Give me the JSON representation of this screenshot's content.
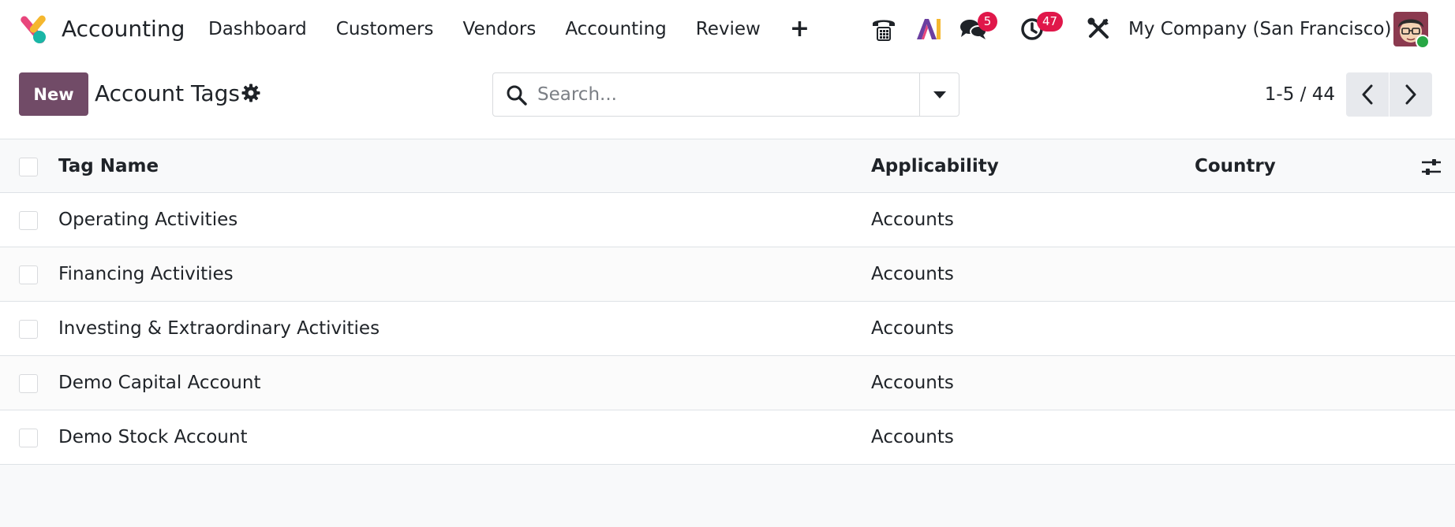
{
  "app": {
    "name": "Accounting",
    "menu": [
      "Dashboard",
      "Customers",
      "Vendors",
      "Accounting",
      "Review"
    ],
    "menu_plus": "+"
  },
  "systray": {
    "messages_count": "5",
    "activities_count": "47",
    "company": "My Company (San Francisco)"
  },
  "control": {
    "new_label": "New",
    "title": "Account Tags",
    "search_placeholder": "Search...",
    "pager": "1-5 / 44"
  },
  "table": {
    "columns": [
      "Tag Name",
      "Applicability",
      "Country"
    ],
    "rows": [
      {
        "name": "Operating Activities",
        "applicability": "Accounts",
        "country": ""
      },
      {
        "name": "Financing Activities",
        "applicability": "Accounts",
        "country": ""
      },
      {
        "name": "Investing & Extraordinary Activities",
        "applicability": "Accounts",
        "country": ""
      },
      {
        "name": "Demo Capital Account",
        "applicability": "Accounts",
        "country": ""
      },
      {
        "name": "Demo Stock Account",
        "applicability": "Accounts",
        "country": ""
      }
    ]
  },
  "colors": {
    "brand": "#714b67",
    "badge": "#e0174a",
    "presence": "#28a745"
  }
}
